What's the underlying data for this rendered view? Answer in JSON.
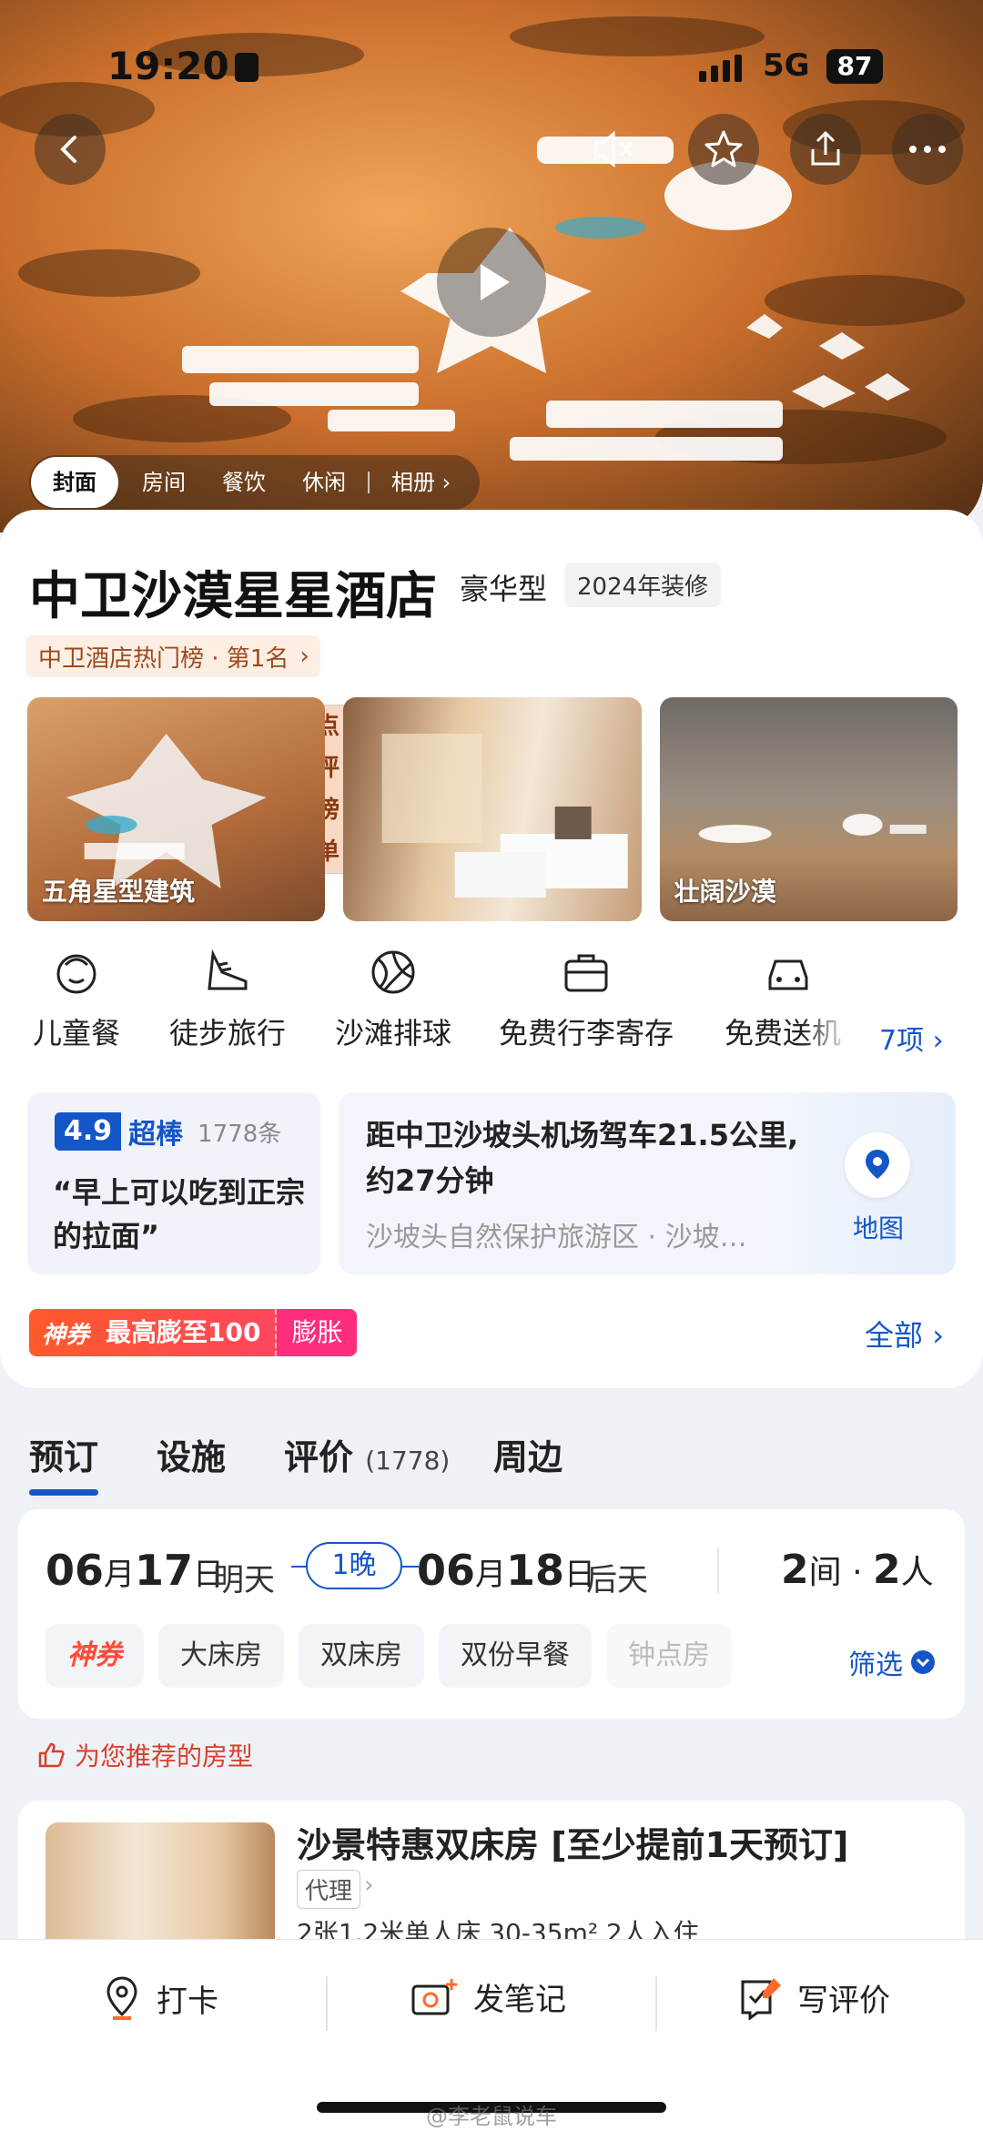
{
  "status": {
    "time": "19:20",
    "network": "5G",
    "battery": "87"
  },
  "hero": {
    "tabs": [
      "封面",
      "房间",
      "餐饮",
      "休闲",
      "相册"
    ],
    "active_tab": "封面"
  },
  "hotel": {
    "name": "中卫沙漠星星酒店",
    "grade": "豪华型",
    "renovation": "2024年装修",
    "rank_tag": "点评榜单",
    "rank_text": "中卫酒店热门榜 · 第1名"
  },
  "photos": [
    "五角星型建筑",
    "",
    "壮阔沙漠"
  ],
  "amenities": [
    "儿童餐",
    "徒步旅行",
    "沙滩排球",
    "免费行李寄存",
    "免费送机"
  ],
  "amenities_more": "7项",
  "review": {
    "score": "4.9",
    "level": "超棒",
    "count": "1778条",
    "quote": "“早上可以吃到正宗的拉面”"
  },
  "location": {
    "distance": "距中卫沙坡头机场驾车21.5公里,约27分钟",
    "address": "沙坡头自然保护旅游区 · 沙坡…",
    "map_label": "地图"
  },
  "coupon": {
    "tag": "神券",
    "text": "最高膨至100",
    "action": "膨胀",
    "all": "全部"
  },
  "main_tabs": [
    {
      "label": "预订",
      "count": ""
    },
    {
      "label": "设施",
      "count": ""
    },
    {
      "label": "评价",
      "count": "(1778)"
    },
    {
      "label": "周边",
      "count": ""
    }
  ],
  "booking": {
    "checkin_month": "06",
    "checkin_day": "17",
    "checkin_label": "明天",
    "nights": "1晚",
    "checkout_month": "06",
    "checkout_day": "18",
    "checkout_label": "后天",
    "rooms": "2",
    "rooms_unit": "间",
    "guests": "2",
    "guests_unit": "人",
    "chips": [
      "神券",
      "大床房",
      "双床房",
      "双份早餐",
      "钟点房"
    ],
    "filter": "筛选"
  },
  "recommend_label": "为您推荐的房型",
  "room": {
    "title": "沙景特惠双床房 [至少提前1天预订]",
    "tag": "代理",
    "spec": "2张1.2米单人床  30-35m²  2人入住"
  },
  "bottom": [
    "打卡",
    "发笔记",
    "写评价"
  ],
  "watermark": "@李老鼠说车",
  "colors": {
    "brand_blue": "#1456c8",
    "coupon_red": "#ff4a3a",
    "rank_brown": "#9b4a1c"
  }
}
